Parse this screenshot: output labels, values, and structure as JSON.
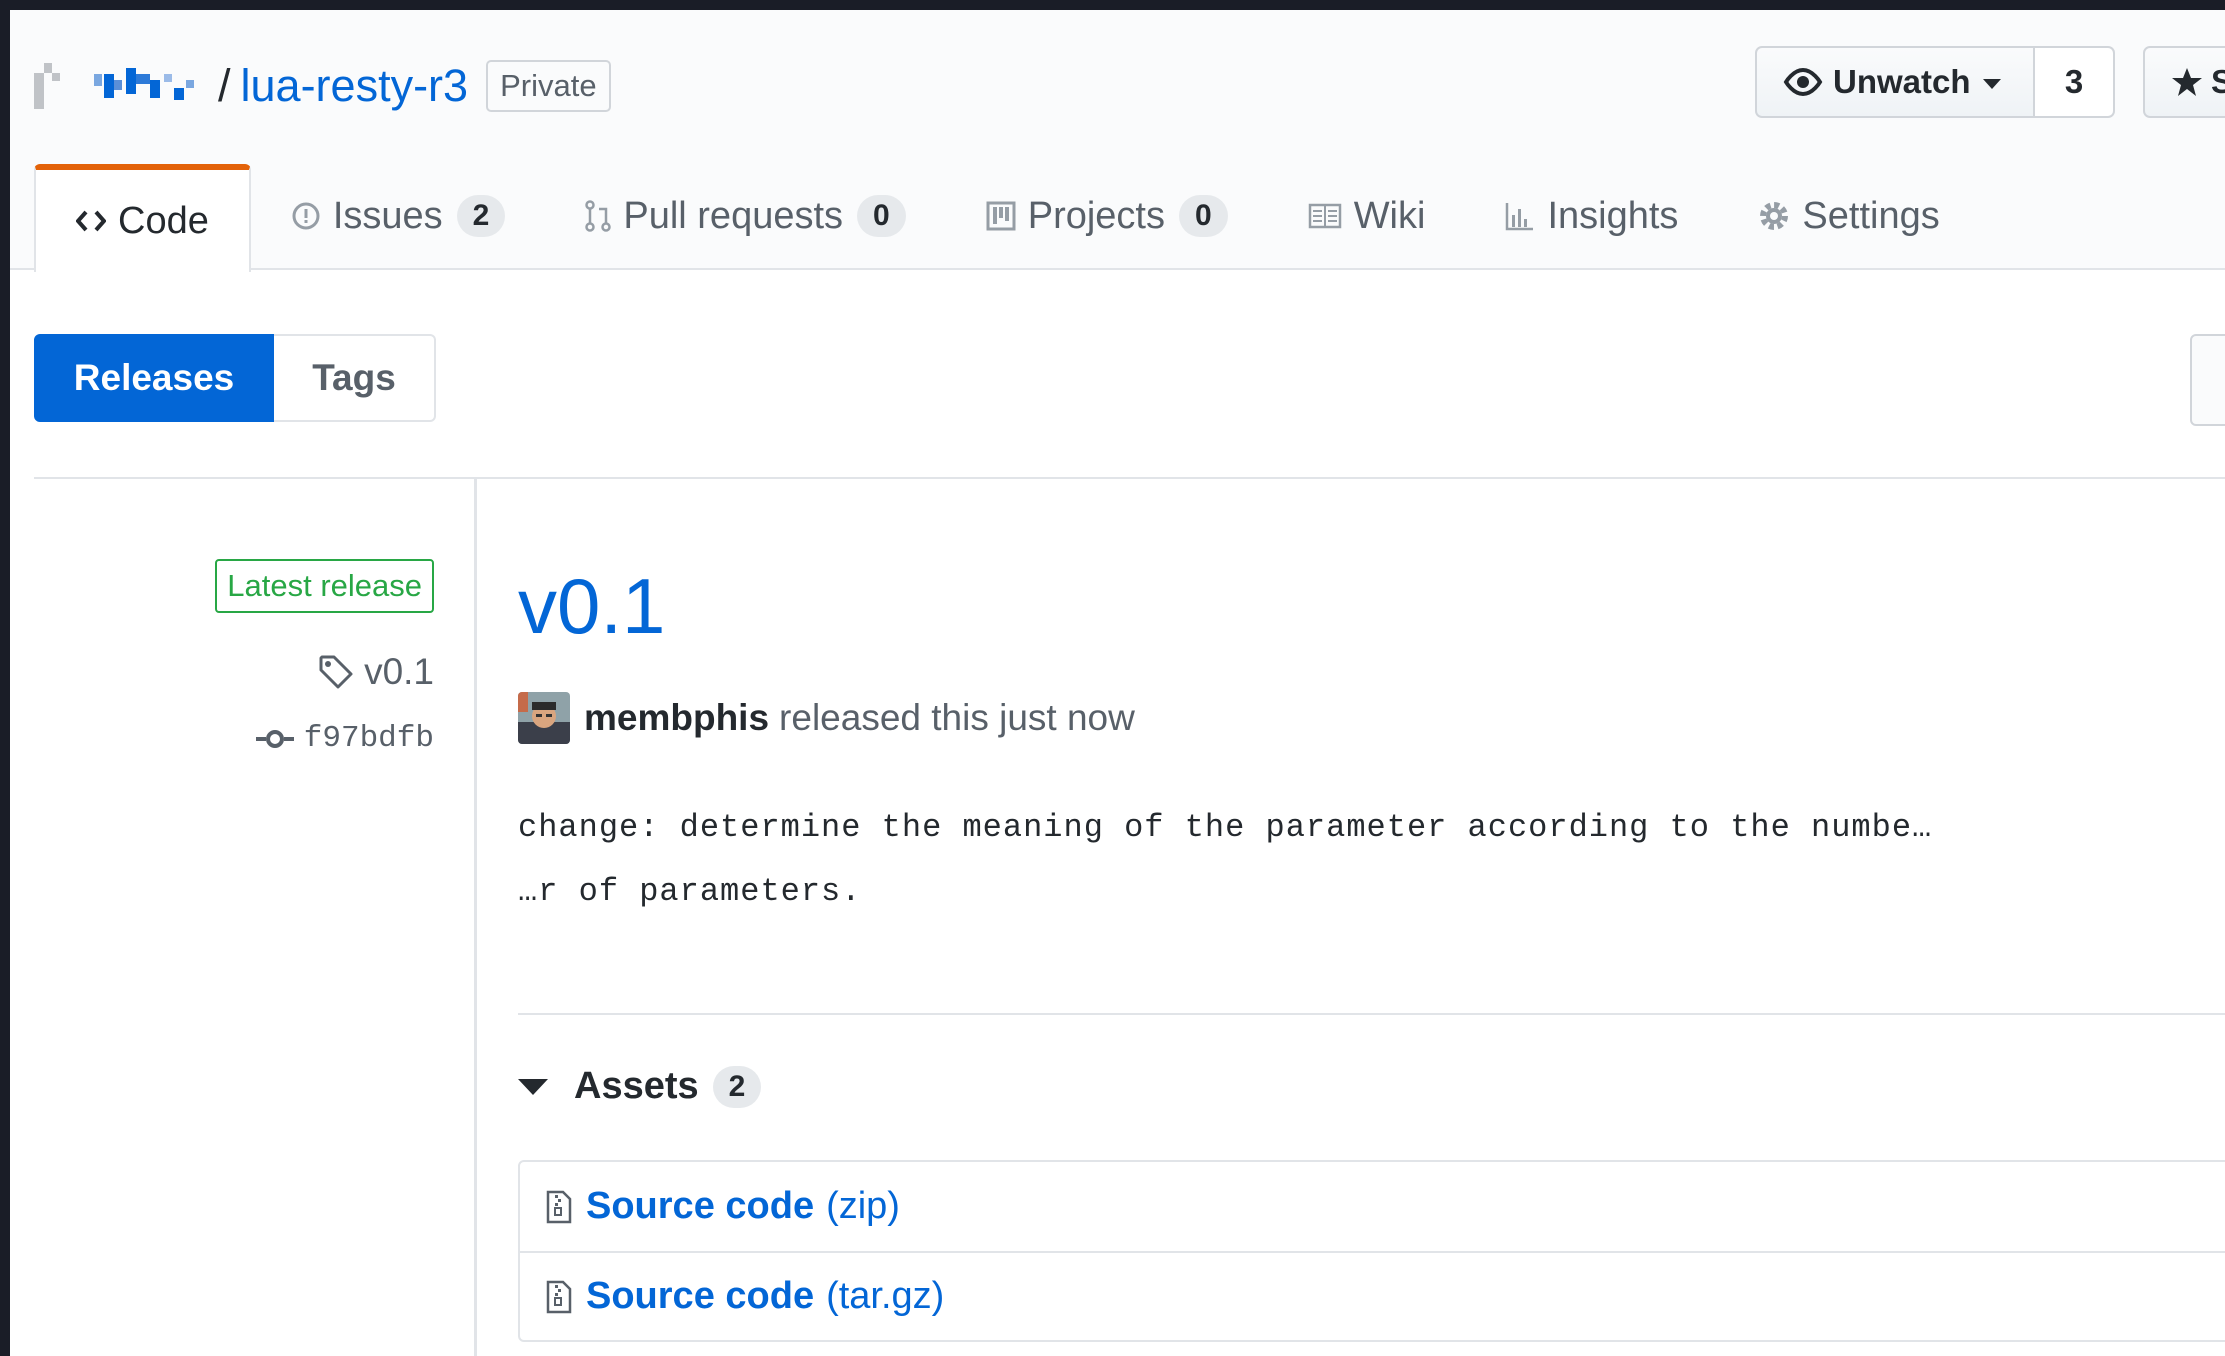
{
  "repo": {
    "owner_label": "",
    "separator": "/",
    "name": "lua-resty-r3",
    "visibility": "Private"
  },
  "actions": {
    "watch_label": "Unwatch",
    "watch_count": "3",
    "star_label": "S"
  },
  "tabs": [
    {
      "label": "Code",
      "icon": "code-icon"
    },
    {
      "label": "Issues",
      "icon": "issue-icon",
      "count": "2"
    },
    {
      "label": "Pull requests",
      "icon": "pull-request-icon",
      "count": "0"
    },
    {
      "label": "Projects",
      "icon": "project-icon",
      "count": "0"
    },
    {
      "label": "Wiki",
      "icon": "book-icon"
    },
    {
      "label": "Insights",
      "icon": "graph-icon"
    },
    {
      "label": "Settings",
      "icon": "gear-icon"
    }
  ],
  "subnav": {
    "releases_label": "Releases",
    "tags_label": "Tags"
  },
  "release": {
    "badge": "Latest release",
    "tag": "v0.1",
    "commit": "f97bdfb",
    "title": "v0.1",
    "author": "membphis",
    "released_text": "released this just now",
    "body_lines": [
      "change: determine the meaning of the parameter according to the numbe…",
      "…r of parameters."
    ],
    "assets_label": "Assets",
    "assets_count": "2",
    "assets": [
      {
        "name": "Source code",
        "ext": "(zip)"
      },
      {
        "name": "Source code",
        "ext": "(tar.gz)"
      }
    ]
  },
  "colors": {
    "link": "#0366d6",
    "accent_tab": "#e36209",
    "latest_green": "#28a745",
    "primary_button": "#0366d6"
  }
}
